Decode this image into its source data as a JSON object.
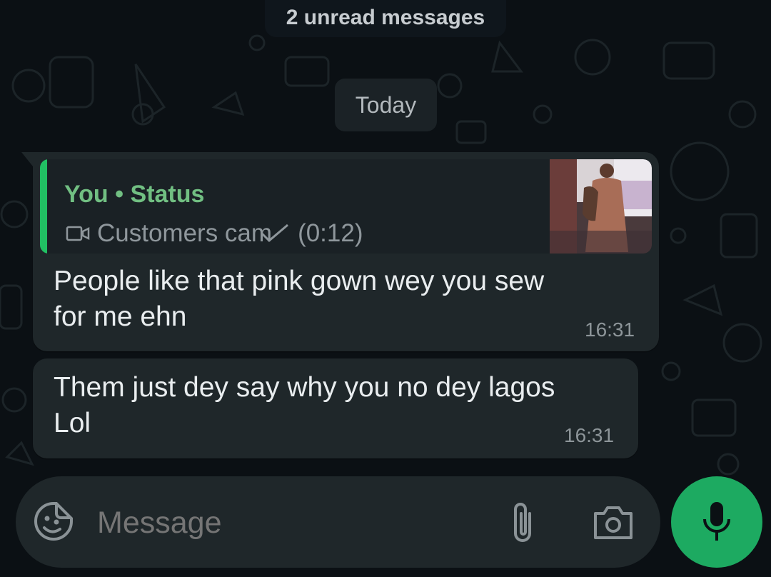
{
  "chat": {
    "unread_banner": "2 unread messages",
    "date_chip": "Today"
  },
  "messages": [
    {
      "quote": {
        "author": "You",
        "separator": "•",
        "source": "Status",
        "caption": "Customers cam",
        "duration": "(0:12)",
        "media_icon": "video-camera-icon"
      },
      "text": "People like that pink gown wey you sew\nfor me ehn",
      "time": "16:31"
    },
    {
      "text": "Them just dey say why you no dey lagos\nLol",
      "time": "16:31"
    }
  ],
  "composer": {
    "placeholder": "Message",
    "icons": [
      "emoji-sticker-icon",
      "paperclip-icon",
      "camera-icon",
      "microphone-icon"
    ]
  },
  "colors": {
    "background": "#0b1014",
    "bubble": "#1f272a",
    "quote_accent": "#21c063",
    "quote_author": "#71bf82",
    "mic_button": "#1daa61"
  }
}
